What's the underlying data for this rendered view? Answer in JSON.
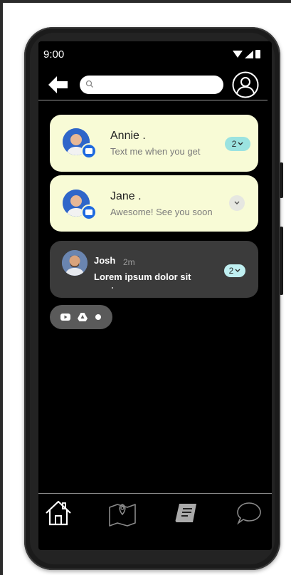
{
  "status": {
    "time": "9:00"
  },
  "search": {
    "placeholder": ""
  },
  "notifications": [
    {
      "name": "Annie  .",
      "message": "Text me when you get",
      "count": "2"
    },
    {
      "name": "Jane  .",
      "message": "Awesome! See you soon"
    },
    {
      "name": "Josh",
      "time": "2m",
      "message": "Lorem ipsum dolor sit",
      "count": "2"
    }
  ],
  "colors": {
    "card_light": "#f8fbd6",
    "card_dark": "#3b3b3b",
    "count_badge": "#9be3e0",
    "app_badge": "#1e6ae0"
  },
  "icons": {
    "back": "arrow-left-icon",
    "profile": "user-circle-icon",
    "apps": [
      "youtube-icon",
      "google-drive-icon",
      "dot-icon"
    ],
    "nav": [
      "home-icon",
      "map-icon",
      "book-icon",
      "chat-icon"
    ]
  }
}
